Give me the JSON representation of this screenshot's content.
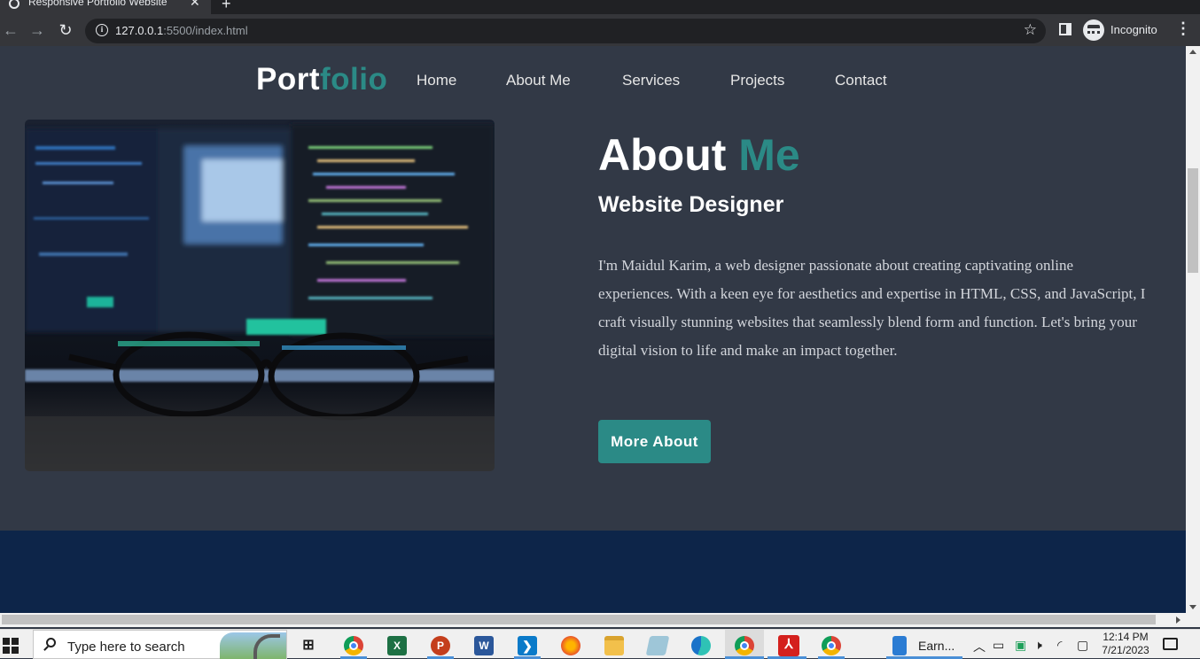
{
  "browser": {
    "tab_title": "Responsive Portfolio Website",
    "url_host": "127.0.0.1",
    "url_rest": ":5500/index.html",
    "profile_label": "Incognito"
  },
  "page": {
    "logo_main": "Port",
    "logo_accent": "folio",
    "nav": [
      "Home",
      "About Me",
      "Services",
      "Projects",
      "Contact"
    ],
    "heading_main": "About ",
    "heading_accent": "Me",
    "subheading": "Website Designer",
    "bio": "I'm Maidul Karim, a web designer passionate about creating captivating online experiences. With a keen eye for aesthetics and expertise in HTML, CSS, and JavaScript, I craft visually stunning websites that seamlessly blend form and function. Let's bring your digital vision to life and make an impact together.",
    "button": "More About",
    "colors": {
      "background": "#323946",
      "accent": "#2b8a86",
      "next_section": "#0d2549"
    }
  },
  "taskbar": {
    "search_placeholder": "Type here to search",
    "pinned_label": "Earn...",
    "time": "12:14 PM",
    "date": "7/21/2023"
  }
}
